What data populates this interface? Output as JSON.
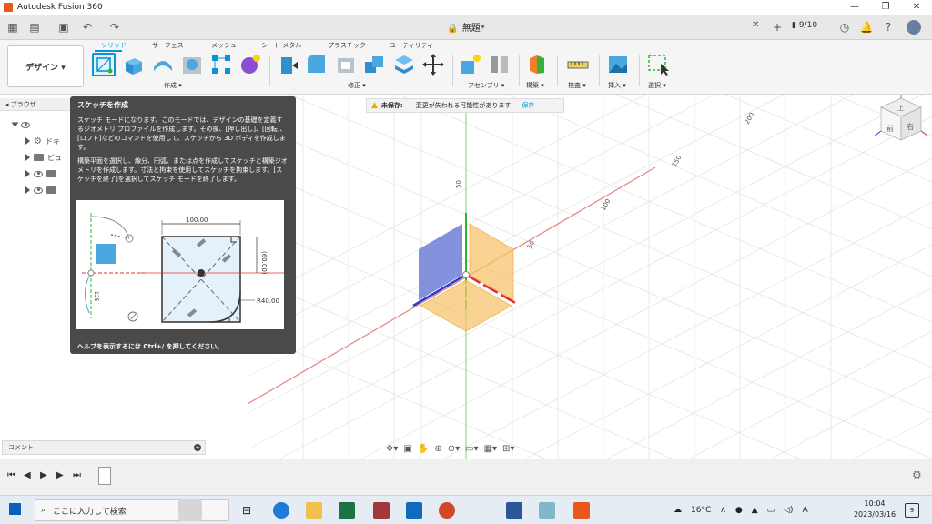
{
  "titlebar": {
    "title": "Autodesk Fusion 360",
    "minimize": "—",
    "maximize": "❐",
    "close": "✕"
  },
  "tabbar": {
    "document_title": "無題*",
    "job_status": "9/10"
  },
  "ribbon": {
    "workspace": "デザイン ▾",
    "tabs": [
      "ソリッド",
      "サーフェス",
      "メッシュ",
      "シート メタル",
      "プラスチック",
      "ユーティリティ"
    ],
    "groups": [
      "作成 ▾",
      "修正 ▾",
      "アセンブリ ▾",
      "構築 ▾",
      "検査 ▾",
      "挿入 ▾",
      "選択 ▾"
    ]
  },
  "browser": {
    "header": "ブラウザ",
    "items": [
      "",
      "ドキ",
      "ビュ",
      "",
      ""
    ]
  },
  "unsaved_banner": {
    "label": "未保存:",
    "message": "変更が失われる可能性があります",
    "save": "保存"
  },
  "tooltip": {
    "title": "スケッチを作成",
    "para1": "スケッチ モードになります。このモードでは、デザインの基礎を定義するジオメトリ プロファイルを作成します。その後、[押し出し]、[回転]、[ロフト]などのコマンドを使用して、スケッチから 3D ボディを作成します。",
    "para2": "構築平面を選択し、線分、円弧、または点を作成してスケッチと構築ジオメトリを作成します。寸法と拘束を使用してスケッチを拘束します。[スケッチを終了]を選択してスケッチ モードを終了します。",
    "help": "ヘルプを表示するには Ctrl+/ を押してください。",
    "dim_width": "100.00",
    "dim_height": "(60.00)",
    "dim_radius": "R40.00",
    "dim_side": "125"
  },
  "viewport": {
    "axis_labels": [
      "50",
      "100",
      "50",
      "150",
      "200"
    ],
    "viewcube": {
      "top": "上",
      "front": "前",
      "right": "右"
    }
  },
  "comments": {
    "label": "コメント"
  },
  "taskbar": {
    "search_placeholder": "ここに入力して検索",
    "weather": "16°C",
    "ime": "A",
    "time": "10:04",
    "date": "2023/03/16",
    "notifications": "9"
  },
  "colors": {
    "accent": "#0696d7",
    "tooltip_bg": "#4a4a4a",
    "x_axis": "#e03030",
    "y_axis": "#2ab82a",
    "z_axis": "#2a3cd8",
    "plane_orange": "#f7c46c",
    "plane_blue": "#6f7ed6"
  }
}
